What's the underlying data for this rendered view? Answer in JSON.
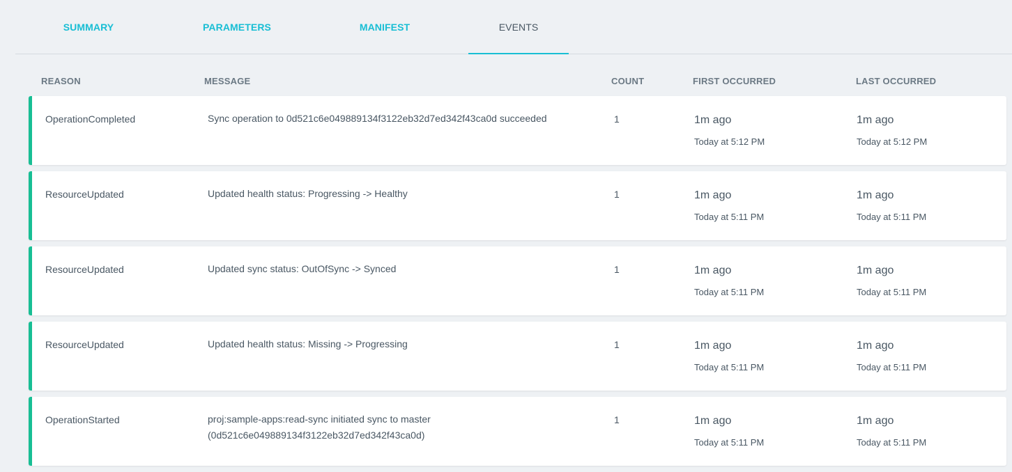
{
  "tabs": [
    {
      "label": "SUMMARY",
      "active": false
    },
    {
      "label": "PARAMETERS",
      "active": false
    },
    {
      "label": "MANIFEST",
      "active": false
    },
    {
      "label": "EVENTS",
      "active": true
    }
  ],
  "columns": {
    "reason": "REASON",
    "message": "MESSAGE",
    "count": "COUNT",
    "first_occurred": "FIRST OCCURRED",
    "last_occurred": "LAST OCCURRED"
  },
  "events": [
    {
      "reason": "OperationCompleted",
      "message": "Sync operation to 0d521c6e049889134f3122eb32d7ed342f43ca0d succeeded",
      "count": "1",
      "first_ago": "1m ago",
      "first_time": "Today at 5:12 PM",
      "last_ago": "1m ago",
      "last_time": "Today at 5:12 PM"
    },
    {
      "reason": "ResourceUpdated",
      "message": "Updated health status: Progressing -> Healthy",
      "count": "1",
      "first_ago": "1m ago",
      "first_time": "Today at 5:11 PM",
      "last_ago": "1m ago",
      "last_time": "Today at 5:11 PM"
    },
    {
      "reason": "ResourceUpdated",
      "message": "Updated sync status: OutOfSync -> Synced",
      "count": "1",
      "first_ago": "1m ago",
      "first_time": "Today at 5:11 PM",
      "last_ago": "1m ago",
      "last_time": "Today at 5:11 PM"
    },
    {
      "reason": "ResourceUpdated",
      "message": "Updated health status: Missing -> Progressing",
      "count": "1",
      "first_ago": "1m ago",
      "first_time": "Today at 5:11 PM",
      "last_ago": "1m ago",
      "last_time": "Today at 5:11 PM"
    },
    {
      "reason": "OperationStarted",
      "message": "proj:sample-apps:read-sync initiated sync to master (0d521c6e049889134f3122eb32d7ed342f43ca0d)",
      "count": "1",
      "first_ago": "1m ago",
      "first_time": "Today at 5:11 PM",
      "last_ago": "1m ago",
      "last_time": "Today at 5:11 PM"
    }
  ],
  "colors": {
    "accent": "#18bed4",
    "event_bar": "#18be94",
    "background": "#eef1f4"
  }
}
